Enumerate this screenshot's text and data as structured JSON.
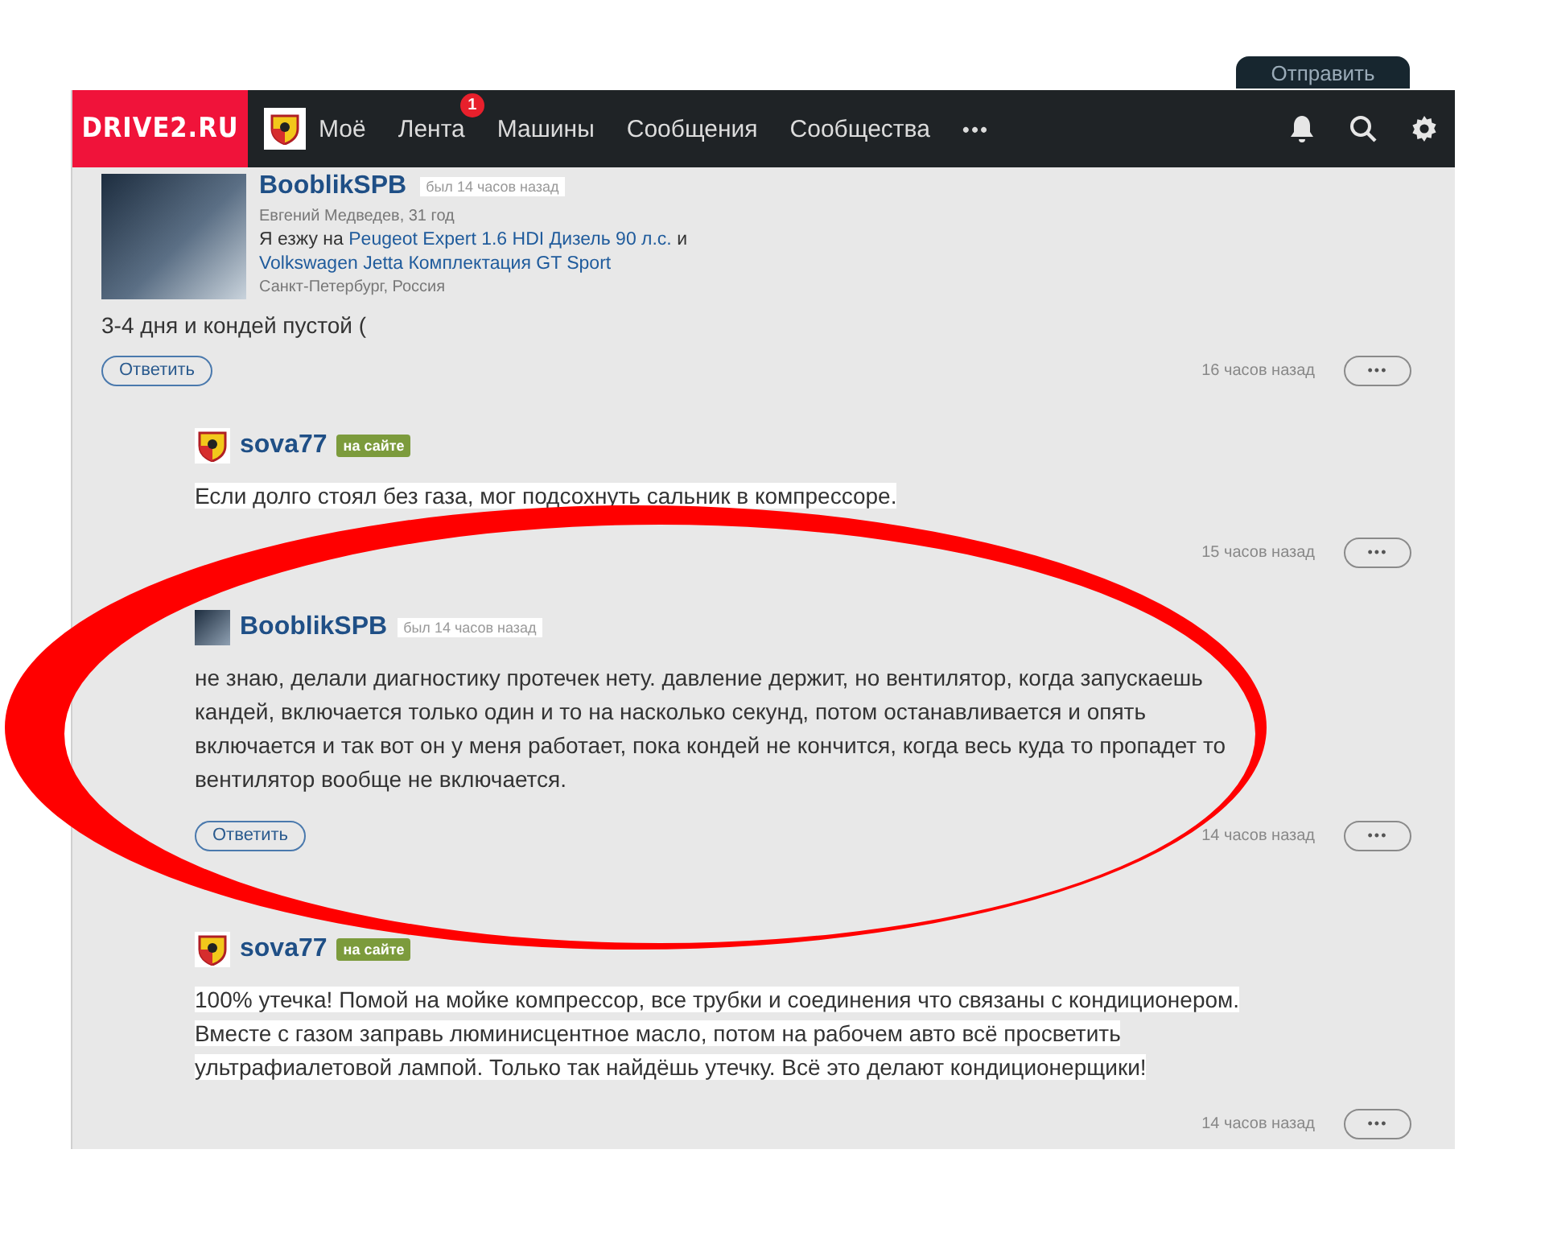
{
  "header": {
    "logo": "DRIVE2.RU",
    "send_button": "Отправить",
    "more": "•••",
    "nav": [
      {
        "label": "Моё"
      },
      {
        "label": "Лента",
        "badge": "1"
      },
      {
        "label": "Машины"
      },
      {
        "label": "Сообщения"
      },
      {
        "label": "Сообщества"
      }
    ]
  },
  "post": {
    "author": "BooblikSPB",
    "status": "был 14 часов назад",
    "name_age": "Евгений Медведев, 31 год",
    "drives": [
      {
        "kind": "plain",
        "text": "Я езжу на "
      },
      {
        "kind": "link",
        "text": "Peugeot Expert 1.6 HDI Дизель 90 л.с."
      },
      {
        "kind": "plain",
        "text": " и "
      },
      {
        "kind": "link",
        "text": "Volkswagen Jetta Комплектация GT Sport"
      }
    ],
    "location": "Санкт-Петербург, Россия",
    "text": "3-4 дня и кондей пустой (",
    "reply": "Ответить",
    "time": "16 часов назад",
    "more": "•••"
  },
  "comments": [
    {
      "author": "sova77",
      "kind": "online",
      "status": "на сайте",
      "text": "Если долго стоял без газа, мог подсохнуть сальник в компрессоре.",
      "highlighted": true,
      "time": "15 часов назад",
      "more": "•••"
    },
    {
      "author": "BooblikSPB",
      "kind": "offline",
      "status": "был 14 часов назад",
      "text": "не знаю, делали диагностику протечек нету. давление держит, но вентилятор, когда запускаешь кандей, включается только один и то на насколько секунд, потом останавливается и опять включается и так вот он у меня работает, пока кондей не кончится, когда весь куда то пропадет то вентилятор вообще не включается.",
      "highlighted": false,
      "reply": "Ответить",
      "time": "14 часов назад",
      "more": "•••"
    },
    {
      "author": "sova77",
      "kind": "online",
      "status": "на сайте",
      "text": "100% утечка! Помой на мойке компрессор, все трубки и соединения что связаны с кондиционером. Вместе с газом заправь люминисцентное масло, потом на рабочем авто всё просветить ультрафиалетовой лампой. Только так найдёшь утечку. Всё это делают кондиционерщики!",
      "highlighted": true,
      "time": "14 часов назад",
      "more": "•••"
    }
  ]
}
